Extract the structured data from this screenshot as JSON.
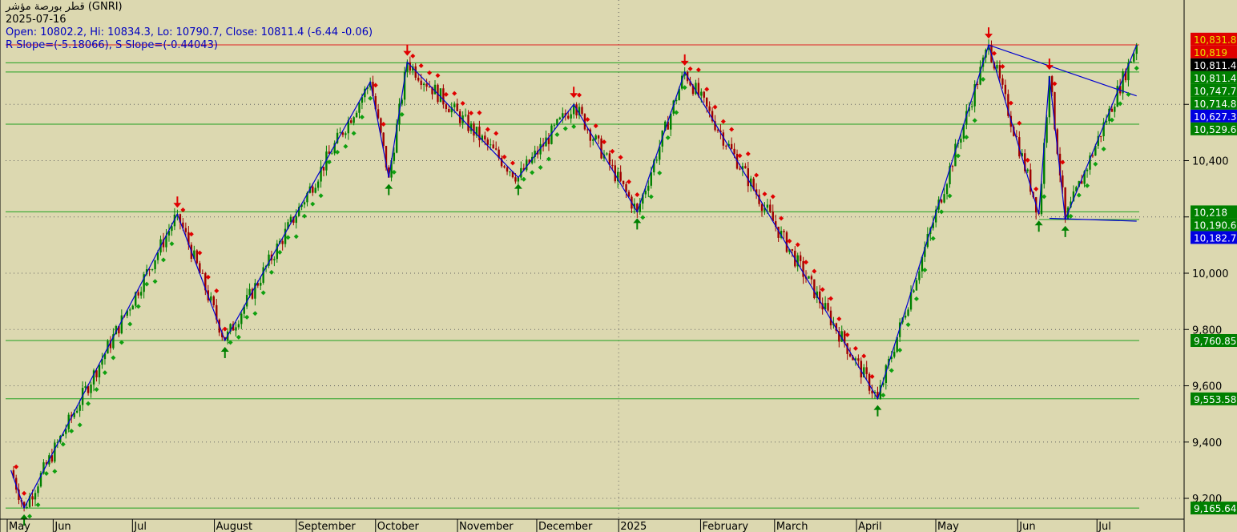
{
  "header": {
    "title": "قطر بورصة مؤشر (GNRI)",
    "date": "2025-07-16",
    "ohlc": "Open: 10802.2, Hi: 10834.3, Lo: 10790.7, Close: 10811.4 (-6.44 -0.06)",
    "slope": "R Slope=(-5.18066), S Slope=(-0.44043)"
  },
  "colors": {
    "background": "#dcd8b0",
    "up_candle": "#008000",
    "down_candle": "#a00000",
    "zigzag": "#0000d0",
    "support_line": "#20a020",
    "resistance_line": "#e02020",
    "up_arrow": "#008000",
    "down_arrow": "#e00000",
    "sar_up": "#10a010",
    "sar_down": "#e00000"
  },
  "chart_data": {
    "type": "candlestick",
    "grid": "dotted",
    "ylim": [
      9150,
      10840
    ],
    "y_ticks": [
      9200,
      9400,
      9600,
      9800,
      10000,
      10200,
      10400,
      10600
    ],
    "y_tick_labels": [
      "9,200",
      "9,400",
      "9,600",
      "9,800",
      "10,000",
      "10,200",
      "10,400",
      "10,600"
    ],
    "x_months": [
      "May",
      "Jun",
      "Jul",
      "August",
      "September",
      "October",
      "November",
      "December",
      "2025",
      "February",
      "March",
      "April",
      "May",
      "Jun",
      "Jul"
    ],
    "zigzag_points": [
      [
        "2024-05-16",
        9300
      ],
      [
        "2024-05-21",
        9166
      ],
      [
        "2024-07-18",
        10210
      ],
      [
        "2024-08-05",
        9761
      ],
      [
        "2024-09-29",
        10680
      ],
      [
        "2024-10-06",
        10340
      ],
      [
        "2024-10-13",
        10750
      ],
      [
        "2024-11-24",
        10340
      ],
      [
        "2024-12-15",
        10600
      ],
      [
        "2025-01-08",
        10218
      ],
      [
        "2025-01-26",
        10715
      ],
      [
        "2025-04-09",
        9554
      ],
      [
        "2025-05-21",
        10811
      ],
      [
        "2025-06-09",
        10210
      ],
      [
        "2025-06-13",
        10700
      ],
      [
        "2025-06-19",
        10191
      ],
      [
        "2025-07-16",
        10811
      ]
    ],
    "horizontal_levels": [
      {
        "value": 10811.4,
        "color": "red"
      },
      {
        "value": 10747.7,
        "color": "green"
      },
      {
        "value": 10714.8,
        "color": "green"
      },
      {
        "value": 10529.6,
        "color": "green"
      },
      {
        "value": 10218,
        "color": "green"
      },
      {
        "value": 9760.85,
        "color": "green"
      },
      {
        "value": 9553.58,
        "color": "green"
      },
      {
        "value": 9165.64,
        "color": "green"
      }
    ],
    "trendlines": [
      {
        "from": [
          "2025-05-21",
          10811
        ],
        "to": [
          "2025-07-16",
          10630
        ]
      },
      {
        "from": [
          "2025-06-13",
          10195
        ],
        "to": [
          "2025-07-16",
          10185
        ]
      }
    ],
    "price_labels": [
      {
        "text": "10,831.8",
        "bg": "#e00000",
        "fg": "#e8e000",
        "value": 10831.8
      },
      {
        "text": "10,819",
        "bg": "#e00000",
        "fg": "#e8e000",
        "value": 10819
      },
      {
        "text": "10,811.4",
        "bg": "#000000",
        "fg": "#ffffff",
        "value": 10811.4
      },
      {
        "text": "10,811.4",
        "bg": "#008000",
        "fg": "#ffffff",
        "value": 10811.4
      },
      {
        "text": "10,747.7",
        "bg": "#008000",
        "fg": "#ffffff",
        "value": 10747.7
      },
      {
        "text": "10,714.8",
        "bg": "#008000",
        "fg": "#ffffff",
        "value": 10714.8
      },
      {
        "text": "10,627.3",
        "bg": "#0000e0",
        "fg": "#ffffff",
        "value": 10627.3
      },
      {
        "text": "10,529.6",
        "bg": "#008000",
        "fg": "#ffffff",
        "value": 10529.6
      },
      {
        "text": "10,218",
        "bg": "#008000",
        "fg": "#ffffff",
        "value": 10218
      },
      {
        "text": "10,190.6",
        "bg": "#008000",
        "fg": "#ffffff",
        "value": 10190.6
      },
      {
        "text": "10,182.7",
        "bg": "#0000e0",
        "fg": "#ffffff",
        "value": 10182.7
      },
      {
        "text": "9,760.85",
        "bg": "#008000",
        "fg": "#ffffff",
        "value": 9760.85
      },
      {
        "text": "9,553.58",
        "bg": "#008000",
        "fg": "#ffffff",
        "value": 9553.58
      },
      {
        "text": "9,165.64",
        "bg": "#008000",
        "fg": "#ffffff",
        "value": 9165.64
      }
    ],
    "up_arrows": [
      [
        "2024-05-21",
        9166
      ],
      [
        "2024-08-05",
        9761
      ],
      [
        "2024-10-06",
        10340
      ],
      [
        "2024-11-24",
        10340
      ],
      [
        "2025-01-08",
        10218
      ],
      [
        "2025-04-09",
        9554
      ],
      [
        "2025-06-09",
        10210
      ],
      [
        "2025-06-19",
        10191
      ]
    ],
    "down_arrows": [
      [
        "2024-07-18",
        10210
      ],
      [
        "2024-10-13",
        10750
      ],
      [
        "2024-12-15",
        10600
      ],
      [
        "2025-01-26",
        10715
      ],
      [
        "2025-05-21",
        10811
      ],
      [
        "2025-06-13",
        10700
      ]
    ],
    "ohlc_last": {
      "date": "2025-07-16",
      "open": 10802.2,
      "high": 10834.3,
      "low": 10790.7,
      "close": 10811.4
    }
  }
}
